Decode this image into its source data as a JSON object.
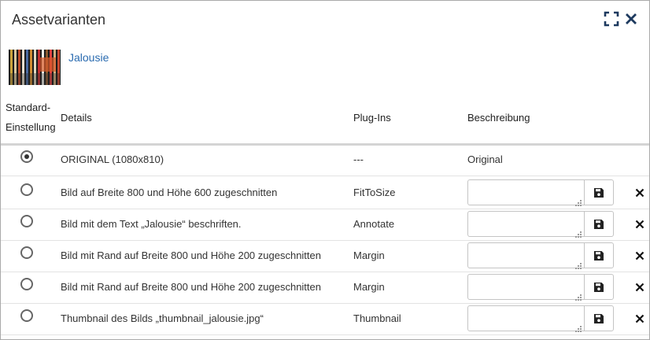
{
  "dialog": {
    "title": "Assetvarianten",
    "maximize_icon": "expand-icon",
    "close_icon": "close-icon"
  },
  "asset": {
    "name": "Jalousie"
  },
  "table": {
    "columns": {
      "default_line1": "Standard-",
      "default_line2": "Einstellung",
      "details": "Details",
      "plugins": "Plug-Ins",
      "description": "Beschreibung"
    },
    "rows": [
      {
        "selected": true,
        "details": "ORIGINAL (1080x810)",
        "plugin": "---",
        "description": "Original",
        "editable": false
      },
      {
        "selected": false,
        "details": "Bild auf Breite 800 und Höhe 600 zugeschnitten",
        "plugin": "FitToSize",
        "description": "",
        "editable": true
      },
      {
        "selected": false,
        "details": "Bild mit dem Text „Jalousie“ beschriften.",
        "plugin": "Annotate",
        "description": "",
        "editable": true
      },
      {
        "selected": false,
        "details": "Bild mit Rand auf Breite 800 und Höhe 200 zugeschnitten",
        "plugin": "Margin",
        "description": "",
        "editable": true
      },
      {
        "selected": false,
        "details": "Bild mit Rand auf Breite 800 und Höhe 200 zugeschnitten",
        "plugin": "Margin",
        "description": "",
        "editable": true
      },
      {
        "selected": false,
        "details": "Thumbnail des Bilds „thumbnail_jalousie.jpg“",
        "plugin": "Thumbnail",
        "description": "",
        "editable": true
      }
    ],
    "save_icon": "save-icon",
    "delete_icon": "delete-icon"
  },
  "colors": {
    "link": "#2a6bb0",
    "icon_dark": "#1e3a5f"
  }
}
